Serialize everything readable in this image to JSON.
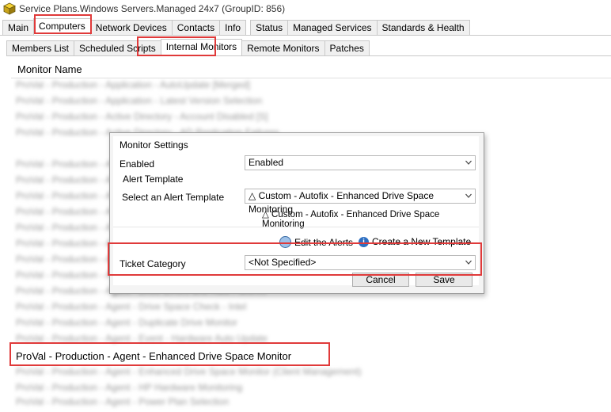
{
  "window": {
    "title": "Service Plans.Windows Servers.Managed 24x7   (GroupID: 856)"
  },
  "main_tabs": [
    "Main",
    "Computers",
    "Network Devices",
    "Contacts",
    "Info",
    "Status",
    "Managed Services",
    "Standards & Health"
  ],
  "sub_tabs": [
    "Members List",
    "Scheduled Scripts",
    "Internal Monitors",
    "Remote Monitors",
    "Patches"
  ],
  "list": {
    "column_header": "Monitor Name",
    "selected_row": "ProVal - Production - Agent - Enhanced Drive Space Monitor",
    "blurred_rows": [
      "ProVal - Production - Application - AutoUpdate [Merged]",
      "ProVal - Production - Application - Latest Version Selection",
      "ProVal - Production - Active Directory - Account Disabled [S]",
      "ProVal - Production - Active Directory - AD Replication Failures",
      "ProVal - Production - Agent - Service Status Check",
      "ProVal - Production - Agent - Disk Health",
      "ProVal - Production - Agent - Event Log",
      "ProVal - Production - Agent - Backup",
      "ProVal - Production - Agent - Reboot",
      "ProVal - Production - Agent - Uptime",
      "ProVal - Production - Agent - Services",
      "ProVal - Production - Agent - Patching",
      "ProVal - Production - Agent - Antivirus",
      "ProVal - Production - Agent - Drive Errors and Raid Failures",
      "ProVal - Production - Agent - Drive Space Check - Intel",
      "ProVal - Production - Agent - Duplicate Drive Monitor",
      "ProVal - Production - Agent - Event - Hardware Auto Update",
      "ProVal - Production - Agent - Enhanced Drive Space Monitor (Client Management)",
      "ProVal - Production - Agent - HP Hardware Monitoring",
      "ProVal - Production - Agent - Power Plan Selection"
    ]
  },
  "dialog": {
    "monitor_settings_label": "Monitor Settings",
    "enabled_label": "Enabled",
    "enabled_value": "Enabled",
    "alert_template_label": "Alert Template",
    "select_template_label": "Select an Alert Template",
    "template_value": "△ Custom - Autofix - Enhanced Drive Space Monitoring",
    "template_description": "△ Custom - Autofix - Enhanced Drive Space Monitoring",
    "edit_alerts_label": "Edit the Alerts",
    "create_template_label": "Create a New Template",
    "ticket_category_label": "Ticket Category",
    "ticket_category_value": "<Not Specified>",
    "cancel_label": "Cancel",
    "save_label": "Save"
  },
  "colors": {
    "highlight": "#e03a3a",
    "info_icon": "#2d6fc2"
  }
}
